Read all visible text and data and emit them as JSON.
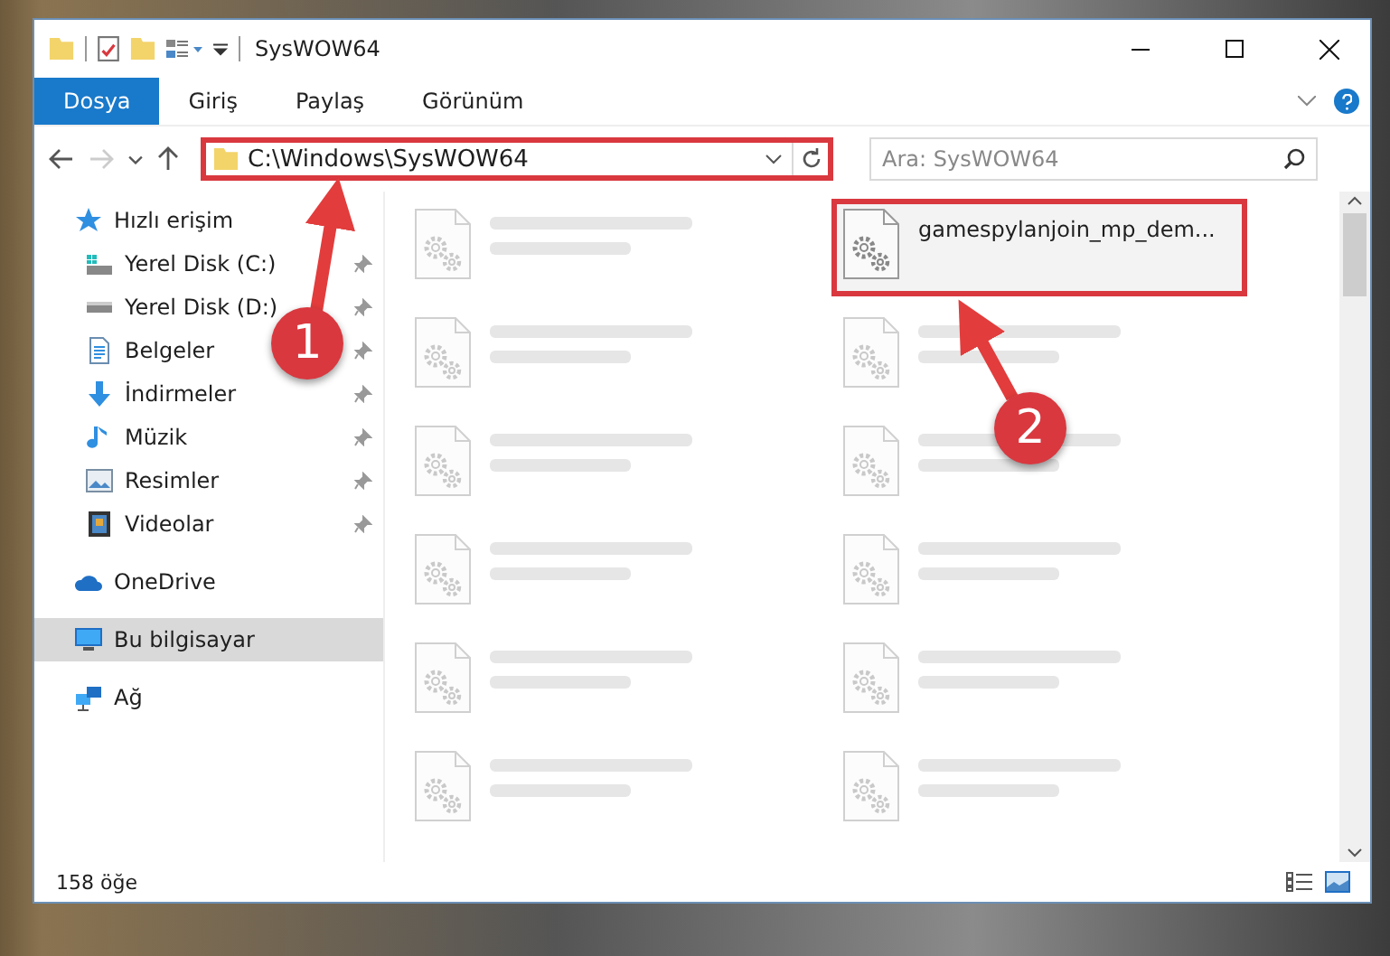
{
  "window": {
    "title": "SysWOW64"
  },
  "ribbon_tabs": [
    {
      "label": "Dosya",
      "selected": true
    },
    {
      "label": "Giriş",
      "selected": false
    },
    {
      "label": "Paylaş",
      "selected": false
    },
    {
      "label": "Görünüm",
      "selected": false
    }
  ],
  "address": {
    "path": "C:\\Windows\\SysWOW64",
    "highlighted": true
  },
  "search": {
    "placeholder": "Ara: SysWOW64"
  },
  "sidebar": {
    "items": [
      {
        "label": "Hızlı erişim",
        "kind": "star",
        "selected": false,
        "children": [
          {
            "label": "Yerel Disk (C:)",
            "kind": "drive-c",
            "selected": false,
            "pinned": true
          },
          {
            "label": "Yerel Disk (D:)",
            "kind": "drive",
            "selected": false,
            "pinned": true
          },
          {
            "label": "Belgeler",
            "kind": "docs",
            "selected": false,
            "pinned": true
          },
          {
            "label": "İndirmeler",
            "kind": "download",
            "selected": false,
            "pinned": true
          },
          {
            "label": "Müzik",
            "kind": "music",
            "selected": false,
            "pinned": true
          },
          {
            "label": "Resimler",
            "kind": "pictures",
            "selected": false,
            "pinned": true
          },
          {
            "label": "Videolar",
            "kind": "videos",
            "selected": false,
            "pinned": true
          }
        ]
      },
      {
        "label": "OneDrive",
        "kind": "cloud",
        "selected": false
      },
      {
        "label": "Bu bilgisayar",
        "kind": "pc",
        "selected": true
      },
      {
        "label": "Ağ",
        "kind": "network",
        "selected": false
      }
    ]
  },
  "files": [
    {
      "blurred": true,
      "selected": false,
      "highlighted": false
    },
    {
      "name": "gamespylanjoin_mp_dem...",
      "blurred": false,
      "selected": true,
      "highlighted": true
    },
    {
      "blurred": true,
      "selected": false,
      "highlighted": false
    },
    {
      "blurred": true,
      "selected": false,
      "highlighted": false
    },
    {
      "blurred": true,
      "selected": false,
      "highlighted": false
    },
    {
      "blurred": true,
      "selected": false,
      "highlighted": false
    },
    {
      "blurred": true,
      "selected": false,
      "highlighted": false
    },
    {
      "blurred": true,
      "selected": false,
      "highlighted": false
    },
    {
      "blurred": true,
      "selected": false,
      "highlighted": false
    },
    {
      "blurred": true,
      "selected": false,
      "highlighted": false
    },
    {
      "blurred": true,
      "selected": false,
      "highlighted": false
    },
    {
      "blurred": true,
      "selected": false,
      "highlighted": false
    }
  ],
  "status_bar": {
    "item_count": "158 öğe"
  },
  "annotations": [
    {
      "label": "1"
    },
    {
      "label": "2"
    }
  ]
}
